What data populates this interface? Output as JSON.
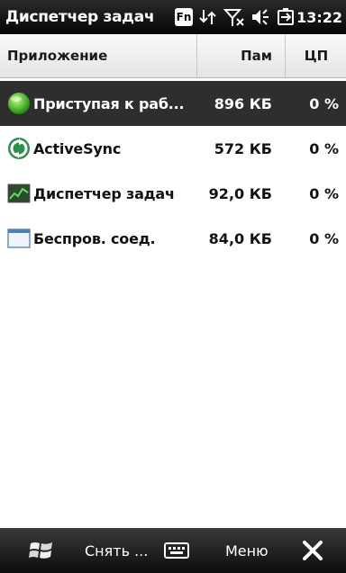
{
  "status_bar": {
    "title": "Диспетчер задач",
    "fn_label": "Fn",
    "time": "13:22",
    "icons": [
      "fn-icon",
      "data-connection-icon",
      "no-signal-icon",
      "volume-icon",
      "battery-charging-icon"
    ]
  },
  "columns": {
    "application": "Приложение",
    "memory": "Пам",
    "cpu": "ЦП"
  },
  "processes": [
    {
      "name": "Приступая к раб...",
      "memory": "896 КБ",
      "cpu": "0 %",
      "icon": "getting-started-icon",
      "selected": true
    },
    {
      "name": "ActiveSync",
      "memory": "572 КБ",
      "cpu": "0 %",
      "icon": "activesync-icon",
      "selected": false
    },
    {
      "name": "Диспетчер задач",
      "memory": "92,0 КБ",
      "cpu": "0 %",
      "icon": "task-manager-icon",
      "selected": false
    },
    {
      "name": "Беспров. соед.",
      "memory": "84,0 КБ",
      "cpu": "0 %",
      "icon": "wireless-icon",
      "selected": false
    }
  ],
  "soft_bar": {
    "left_key": "Снять ...",
    "right_key": "Меню",
    "icons": [
      "windows-start-icon",
      "keyboard-icon",
      "close-icon"
    ]
  },
  "colors": {
    "selected_row": "#2e2e2e",
    "bar_background": "#0c0c0c",
    "header_background": "#e4e4e4"
  }
}
